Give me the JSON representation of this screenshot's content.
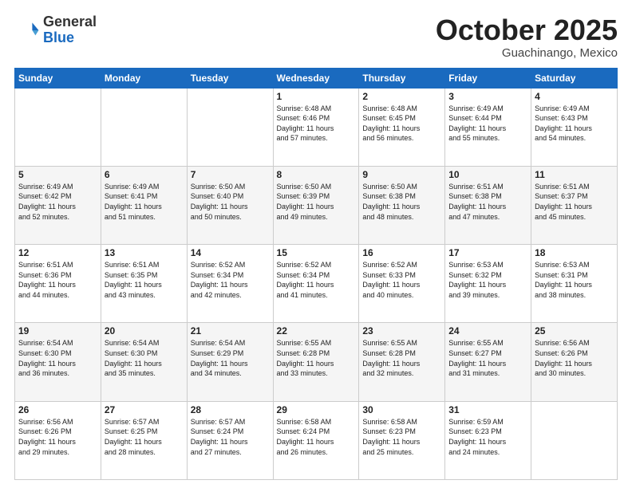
{
  "header": {
    "logo_general": "General",
    "logo_blue": "Blue",
    "title": "October 2025",
    "location": "Guachinango, Mexico"
  },
  "days_of_week": [
    "Sunday",
    "Monday",
    "Tuesday",
    "Wednesday",
    "Thursday",
    "Friday",
    "Saturday"
  ],
  "weeks": [
    [
      {
        "num": "",
        "info": ""
      },
      {
        "num": "",
        "info": ""
      },
      {
        "num": "",
        "info": ""
      },
      {
        "num": "1",
        "info": "Sunrise: 6:48 AM\nSunset: 6:46 PM\nDaylight: 11 hours\nand 57 minutes."
      },
      {
        "num": "2",
        "info": "Sunrise: 6:48 AM\nSunset: 6:45 PM\nDaylight: 11 hours\nand 56 minutes."
      },
      {
        "num": "3",
        "info": "Sunrise: 6:49 AM\nSunset: 6:44 PM\nDaylight: 11 hours\nand 55 minutes."
      },
      {
        "num": "4",
        "info": "Sunrise: 6:49 AM\nSunset: 6:43 PM\nDaylight: 11 hours\nand 54 minutes."
      }
    ],
    [
      {
        "num": "5",
        "info": "Sunrise: 6:49 AM\nSunset: 6:42 PM\nDaylight: 11 hours\nand 52 minutes."
      },
      {
        "num": "6",
        "info": "Sunrise: 6:49 AM\nSunset: 6:41 PM\nDaylight: 11 hours\nand 51 minutes."
      },
      {
        "num": "7",
        "info": "Sunrise: 6:50 AM\nSunset: 6:40 PM\nDaylight: 11 hours\nand 50 minutes."
      },
      {
        "num": "8",
        "info": "Sunrise: 6:50 AM\nSunset: 6:39 PM\nDaylight: 11 hours\nand 49 minutes."
      },
      {
        "num": "9",
        "info": "Sunrise: 6:50 AM\nSunset: 6:38 PM\nDaylight: 11 hours\nand 48 minutes."
      },
      {
        "num": "10",
        "info": "Sunrise: 6:51 AM\nSunset: 6:38 PM\nDaylight: 11 hours\nand 47 minutes."
      },
      {
        "num": "11",
        "info": "Sunrise: 6:51 AM\nSunset: 6:37 PM\nDaylight: 11 hours\nand 45 minutes."
      }
    ],
    [
      {
        "num": "12",
        "info": "Sunrise: 6:51 AM\nSunset: 6:36 PM\nDaylight: 11 hours\nand 44 minutes."
      },
      {
        "num": "13",
        "info": "Sunrise: 6:51 AM\nSunset: 6:35 PM\nDaylight: 11 hours\nand 43 minutes."
      },
      {
        "num": "14",
        "info": "Sunrise: 6:52 AM\nSunset: 6:34 PM\nDaylight: 11 hours\nand 42 minutes."
      },
      {
        "num": "15",
        "info": "Sunrise: 6:52 AM\nSunset: 6:34 PM\nDaylight: 11 hours\nand 41 minutes."
      },
      {
        "num": "16",
        "info": "Sunrise: 6:52 AM\nSunset: 6:33 PM\nDaylight: 11 hours\nand 40 minutes."
      },
      {
        "num": "17",
        "info": "Sunrise: 6:53 AM\nSunset: 6:32 PM\nDaylight: 11 hours\nand 39 minutes."
      },
      {
        "num": "18",
        "info": "Sunrise: 6:53 AM\nSunset: 6:31 PM\nDaylight: 11 hours\nand 38 minutes."
      }
    ],
    [
      {
        "num": "19",
        "info": "Sunrise: 6:54 AM\nSunset: 6:30 PM\nDaylight: 11 hours\nand 36 minutes."
      },
      {
        "num": "20",
        "info": "Sunrise: 6:54 AM\nSunset: 6:30 PM\nDaylight: 11 hours\nand 35 minutes."
      },
      {
        "num": "21",
        "info": "Sunrise: 6:54 AM\nSunset: 6:29 PM\nDaylight: 11 hours\nand 34 minutes."
      },
      {
        "num": "22",
        "info": "Sunrise: 6:55 AM\nSunset: 6:28 PM\nDaylight: 11 hours\nand 33 minutes."
      },
      {
        "num": "23",
        "info": "Sunrise: 6:55 AM\nSunset: 6:28 PM\nDaylight: 11 hours\nand 32 minutes."
      },
      {
        "num": "24",
        "info": "Sunrise: 6:55 AM\nSunset: 6:27 PM\nDaylight: 11 hours\nand 31 minutes."
      },
      {
        "num": "25",
        "info": "Sunrise: 6:56 AM\nSunset: 6:26 PM\nDaylight: 11 hours\nand 30 minutes."
      }
    ],
    [
      {
        "num": "26",
        "info": "Sunrise: 6:56 AM\nSunset: 6:26 PM\nDaylight: 11 hours\nand 29 minutes."
      },
      {
        "num": "27",
        "info": "Sunrise: 6:57 AM\nSunset: 6:25 PM\nDaylight: 11 hours\nand 28 minutes."
      },
      {
        "num": "28",
        "info": "Sunrise: 6:57 AM\nSunset: 6:24 PM\nDaylight: 11 hours\nand 27 minutes."
      },
      {
        "num": "29",
        "info": "Sunrise: 6:58 AM\nSunset: 6:24 PM\nDaylight: 11 hours\nand 26 minutes."
      },
      {
        "num": "30",
        "info": "Sunrise: 6:58 AM\nSunset: 6:23 PM\nDaylight: 11 hours\nand 25 minutes."
      },
      {
        "num": "31",
        "info": "Sunrise: 6:59 AM\nSunset: 6:23 PM\nDaylight: 11 hours\nand 24 minutes."
      },
      {
        "num": "",
        "info": ""
      }
    ]
  ]
}
